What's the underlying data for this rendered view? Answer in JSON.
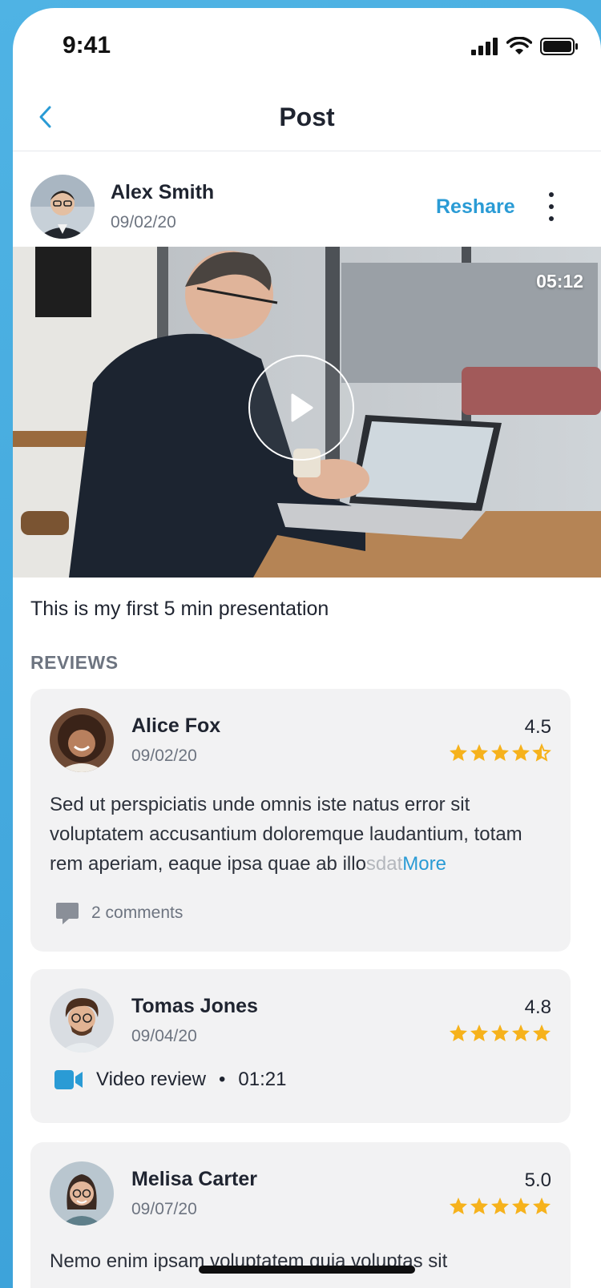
{
  "status_bar": {
    "time": "9:41"
  },
  "nav": {
    "title": "Post"
  },
  "post": {
    "author": "Alex Smith",
    "date": "09/02/20",
    "reshare_label": "Reshare",
    "video_duration": "05:12",
    "caption": "This is my first 5 min presentation"
  },
  "reviews": {
    "heading": "REVIEWS",
    "items": [
      {
        "name": "Alice Fox",
        "date": "09/02/20",
        "score": "4.5",
        "stars": 4.5,
        "body": "Sed ut perspiciatis unde omnis iste natus error sit voluptatem accusantium doloremque laudantium, totam rem aperiam, eaque ipsa quae ab illo",
        "body_faded": "sdat",
        "more_label": "More",
        "comments": "2 comments"
      },
      {
        "name": "Tomas Jones",
        "date": "09/04/20",
        "score": "4.8",
        "stars": 5,
        "video_label": "Video review",
        "video_duration": "01:21"
      },
      {
        "name": "Melisa Carter",
        "date": "09/07/20",
        "score": "5.0",
        "stars": 5,
        "body": "Nemo enim ipsam voluptatem quia voluptas sit"
      }
    ]
  },
  "colors": {
    "accent": "#2a9bd5",
    "star": "#f6b21c",
    "card_bg": "#f2f2f3"
  },
  "icons": [
    "back-chevron-icon",
    "signal-icon",
    "wifi-icon",
    "battery-icon",
    "more-vertical-icon",
    "play-icon",
    "comment-icon",
    "video-camera-icon",
    "star-icon"
  ]
}
